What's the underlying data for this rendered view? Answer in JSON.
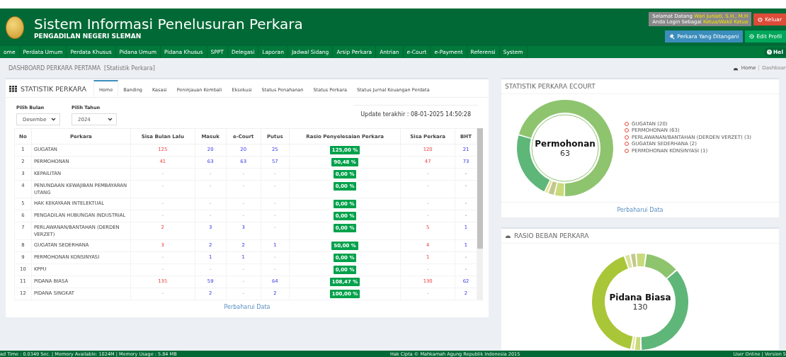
{
  "header": {
    "title": "Sistem Informasi Penelusuran Perkara",
    "subtitle": "PENGADILAN NEGERI SLEMAN",
    "user": {
      "greeting": "Selamat Datang",
      "name": "Wari Juniati, S.H., M.H",
      "role_label": "Anda Login Sebagai",
      "role": "Ketua/Wakil Ketua"
    },
    "logout": "Keluar",
    "cases_button": "Perkara Yang Ditangani",
    "profile_button": "Edit Profil"
  },
  "nav": {
    "items": [
      "ome",
      "Perdata Umum",
      "Perdata Khusus",
      "Pidana Umum",
      "Pidana Khusus",
      "SPPT",
      "Delegasi",
      "Laporan",
      "Jadwal Sidang",
      "Arsip Perkara",
      "Antrian",
      "e-Court",
      "e-Payment",
      "Referensi",
      "System"
    ],
    "help": "Hel"
  },
  "breadcrumb": {
    "title": "DASHBOARD PERKARA PERTAMA",
    "subtitle": "[Statistik Perkara]",
    "items": [
      "Home",
      "Dashboar"
    ]
  },
  "stats_panel": {
    "title": "STATISTIK PERKARA",
    "tabs": [
      {
        "label": "Home",
        "selected": true
      },
      {
        "label": "Banding",
        "selected": false
      },
      {
        "label": "Kasasi",
        "selected": false
      },
      {
        "label": "Peninjauan Kembali",
        "selected": false
      },
      {
        "label": "Eksekusi",
        "selected": false
      },
      {
        "label": "Status Penahanan",
        "selected": false
      },
      {
        "label": "Status Perkara",
        "selected": false
      },
      {
        "label": "Status Jurnal Keuangan Perdata",
        "selected": false
      }
    ],
    "month": {
      "label": "Pilih Bulan",
      "value": "Desembe"
    },
    "year": {
      "label": "Pilih Tahun",
      "value": "2024"
    },
    "updated": "Update terakhir : 08-01-2025 14:50:28",
    "table": {
      "columns": [
        "No",
        "Perkara",
        "Sisa Bulan Lalu",
        "Masuk",
        "e-Court",
        "Putus",
        "Rasio Penyelesaian Perkara",
        "Sisa Perkara",
        "BHT"
      ],
      "rows": [
        [
          "1",
          "GUGATAN",
          "125",
          "20",
          "20",
          "25",
          "125,00 %",
          "120",
          "21"
        ],
        [
          "2",
          "PERMOHONAN",
          "41",
          "63",
          "63",
          "57",
          "90,48 %",
          "47",
          "73"
        ],
        [
          "3",
          "KEPAILITAN",
          "-",
          "-",
          "-",
          "-",
          "0,00 %",
          "-",
          "-"
        ],
        [
          "4",
          "PENUNDAAN KEWAJIBAN PEMBAYARAN UTANG",
          "-",
          "-",
          "-",
          "-",
          "0,00 %",
          "-",
          "-"
        ],
        [
          "5",
          "HAK KEKAYAAN INTELEKTUAL",
          "-",
          "-",
          "-",
          "-",
          "0,00 %",
          "-",
          "-"
        ],
        [
          "6",
          "PENGADILAN HUBUNGAN INDUSTRIAL",
          "-",
          "-",
          "-",
          "-",
          "0,00 %",
          "-",
          "-"
        ],
        [
          "7",
          "PERLAWANAN/BANTAHAN (DERDEN VERZET)",
          "2",
          "3",
          "3",
          "-",
          "0,00 %",
          "5",
          "1"
        ],
        [
          "8",
          "GUGATAN SEDERHANA",
          "3",
          "2",
          "2",
          "1",
          "50,00 %",
          "4",
          "1"
        ],
        [
          "9",
          "PERMOHONAN KONSINYASI",
          "-",
          "1",
          "1",
          "-",
          "0,00 %",
          "1",
          "-"
        ],
        [
          "10",
          "KPPU",
          "-",
          "-",
          "-",
          "-",
          "0,00 %",
          "-",
          "-"
        ],
        [
          "11",
          "PIDANA BIASA",
          "135",
          "59",
          "-",
          "64",
          "108,47 %",
          "130",
          "62"
        ],
        [
          "12",
          "PIDANA SINGKAT",
          "-",
          "2",
          "-",
          "2",
          "100,00 %",
          "-",
          "2"
        ]
      ]
    },
    "refresh": "Perbaharui Data"
  },
  "ecourt_panel": {
    "title": "STATISTIK PERKARA ECOURT",
    "center_label": "Permohonan",
    "center_value": "63",
    "chart_data": {
      "type": "donut",
      "categories": [
        "GUGATAN (20)",
        "PERMOHONAN (63)",
        "PERLAWANAN/BANTAHAN (DERDEN VERZET) (3)",
        "GUGATAN SEDERHANA (2)",
        "PERMOHONAN KONSINYASI (1)"
      ],
      "series": [
        {
          "values": [
            20,
            63,
            3,
            2,
            1
          ]
        }
      ],
      "colors": [
        "#5fb679",
        "#8fc46f",
        "#c9da7c",
        "#c4c78c",
        "#e2e28f"
      ]
    },
    "refresh": "Perbaharui Data"
  },
  "ratio_panel": {
    "title": "RASIO BEBAN PERKARA",
    "center_label": "Pidana Biasa",
    "center_value": "130"
  },
  "footer": {
    "left": "ad Time : 0.0349 Sec. | Memory Available: 1024M | Memory Usage : 5.84 MB",
    "center": "Hak Cipta © Mahkamah Agung Republik Indonesia 2015",
    "right": "User Online | Version 5"
  }
}
